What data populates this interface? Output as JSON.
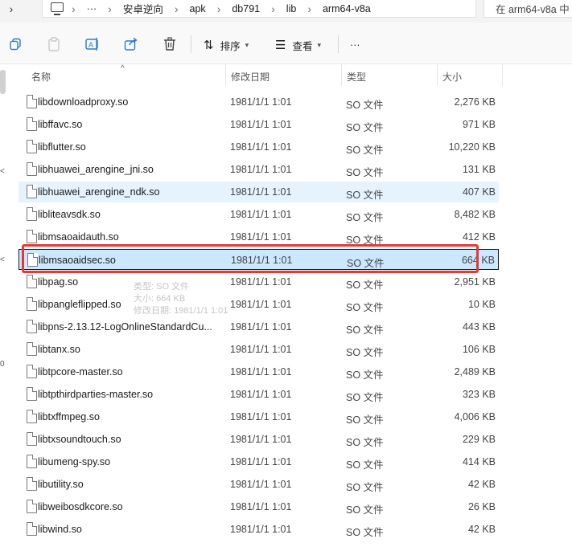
{
  "address": {
    "segments": [
      "安卓逆向",
      "apk",
      "db791",
      "lib",
      "arm64-v8a"
    ],
    "search_placeholder": "在 arm64-v8a 中"
  },
  "toolbar": {
    "sort_label": "排序",
    "view_label": "查看",
    "more_label": "···"
  },
  "columns": {
    "name": "名称",
    "date": "修改日期",
    "type": "类型",
    "size": "大小"
  },
  "files": [
    {
      "name": "libdownloadproxy.so",
      "date": "1981/1/1 1:01",
      "type": "SO 文件",
      "size": "2,276 KB"
    },
    {
      "name": "libffavc.so",
      "date": "1981/1/1 1:01",
      "type": "SO 文件",
      "size": "971 KB"
    },
    {
      "name": "libflutter.so",
      "date": "1981/1/1 1:01",
      "type": "SO 文件",
      "size": "10,220 KB"
    },
    {
      "name": "libhuawei_arengine_jni.so",
      "date": "1981/1/1 1:01",
      "type": "SO 文件",
      "size": "131 KB"
    },
    {
      "name": "libhuawei_arengine_ndk.so",
      "date": "1981/1/1 1:01",
      "type": "SO 文件",
      "size": "407 KB"
    },
    {
      "name": "libliteavsdk.so",
      "date": "1981/1/1 1:01",
      "type": "SO 文件",
      "size": "8,482 KB"
    },
    {
      "name": "libmsaoaidauth.so",
      "date": "1981/1/1 1:01",
      "type": "SO 文件",
      "size": "412 KB"
    },
    {
      "name": "libmsaoaidsec.so",
      "date": "1981/1/1 1:01",
      "type": "SO 文件",
      "size": "664 KB"
    },
    {
      "name": "libpag.so",
      "date": "1981/1/1 1:01",
      "type": "SO 文件",
      "size": "2,951 KB"
    },
    {
      "name": "libpangleflipped.so",
      "date": "1981/1/1 1:01",
      "type": "SO 文件",
      "size": "10 KB"
    },
    {
      "name": "libpns-2.13.12-LogOnlineStandardCu...",
      "date": "1981/1/1 1:01",
      "type": "SO 文件",
      "size": "443 KB"
    },
    {
      "name": "libtanx.so",
      "date": "1981/1/1 1:01",
      "type": "SO 文件",
      "size": "106 KB"
    },
    {
      "name": "libtpcore-master.so",
      "date": "1981/1/1 1:01",
      "type": "SO 文件",
      "size": "2,489 KB"
    },
    {
      "name": "libtpthirdparties-master.so",
      "date": "1981/1/1 1:01",
      "type": "SO 文件",
      "size": "323 KB"
    },
    {
      "name": "libtxffmpeg.so",
      "date": "1981/1/1 1:01",
      "type": "SO 文件",
      "size": "4,006 KB"
    },
    {
      "name": "libtxsoundtouch.so",
      "date": "1981/1/1 1:01",
      "type": "SO 文件",
      "size": "229 KB"
    },
    {
      "name": "libumeng-spy.so",
      "date": "1981/1/1 1:01",
      "type": "SO 文件",
      "size": "414 KB"
    },
    {
      "name": "libutility.so",
      "date": "1981/1/1 1:01",
      "type": "SO 文件",
      "size": "42 KB"
    },
    {
      "name": "libweibosdkcore.so",
      "date": "1981/1/1 1:01",
      "type": "SO 文件",
      "size": "26 KB"
    },
    {
      "name": "libwind.so",
      "date": "1981/1/1 1:01",
      "type": "SO 文件",
      "size": "42 KB"
    }
  ],
  "tooltip": {
    "line1": "类型: SO 文件",
    "line2": "大小: 664 KB",
    "line3": "修改日期: 1981/1/1 1:01"
  },
  "colors": {
    "selection_bg": "#cce8ff",
    "hover_bg": "#e5f3ff",
    "highlight_border": "#e53935"
  }
}
